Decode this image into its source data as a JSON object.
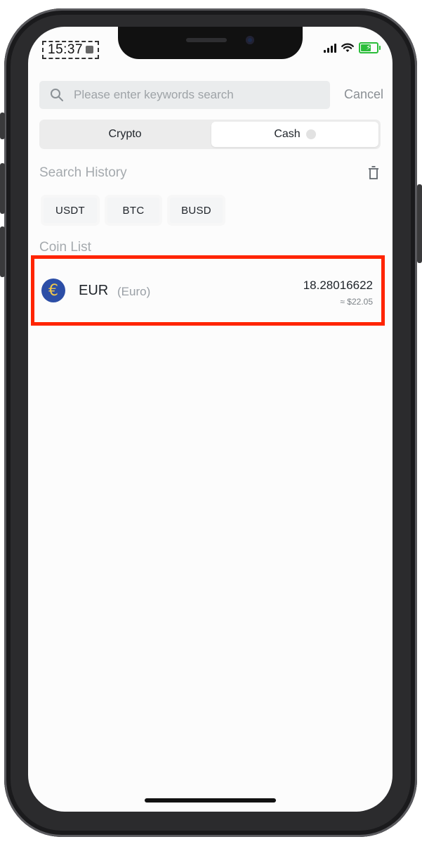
{
  "status_bar": {
    "time": "15:37"
  },
  "search": {
    "placeholder": "Please enter keywords search",
    "cancel_label": "Cancel"
  },
  "segment": {
    "tabs": [
      {
        "label": "Crypto",
        "active": false
      },
      {
        "label": "Cash",
        "active": true
      }
    ]
  },
  "search_history": {
    "title": "Search History",
    "chips": [
      "USDT",
      "BTC",
      "BUSD"
    ]
  },
  "coin_list": {
    "title": "Coin List",
    "items": [
      {
        "code": "EUR",
        "name": "(Euro)",
        "icon_symbol": "€",
        "amount": "18.28016622",
        "usd_value": "≈ $22.05"
      }
    ]
  },
  "colors": {
    "highlight": "#ff2400",
    "coin_icon_bg": "#2c4ea6",
    "coin_icon_fg": "#f2c84b",
    "battery": "#2bbd3a"
  },
  "icons": {
    "search": "magnifier-icon",
    "trash": "trash-icon"
  }
}
